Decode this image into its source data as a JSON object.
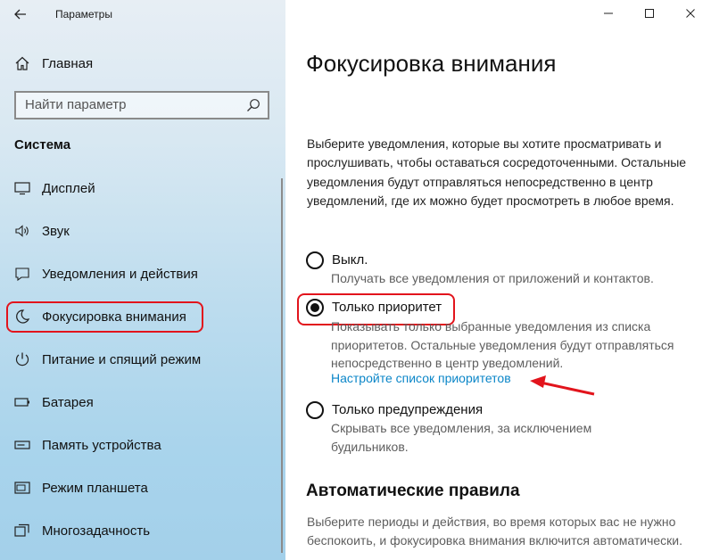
{
  "window": {
    "app_title": "Параметры"
  },
  "sidebar": {
    "home_label": "Главная",
    "search_placeholder": "Найти параметр",
    "section_title": "Система",
    "items": [
      {
        "label": "Дисплей",
        "icon": "display-icon"
      },
      {
        "label": "Звук",
        "icon": "sound-icon"
      },
      {
        "label": "Уведомления и действия",
        "icon": "notifications-icon"
      },
      {
        "label": "Фокусировка внимания",
        "icon": "moon-icon",
        "selected": true
      },
      {
        "label": "Питание и спящий режим",
        "icon": "power-icon"
      },
      {
        "label": "Батарея",
        "icon": "battery-icon"
      },
      {
        "label": "Память устройства",
        "icon": "storage-icon"
      },
      {
        "label": "Режим планшета",
        "icon": "tablet-icon"
      },
      {
        "label": "Многозадачность",
        "icon": "multitasking-icon"
      }
    ]
  },
  "content": {
    "title": "Фокусировка внимания",
    "description": "Выберите уведомления, которые вы хотите просматривать и прослушивать, чтобы оставаться сосредоточенными. Остальные уведомления будут отправляться непосредственно в центр уведомлений, где их можно будет просмотреть в любое время.",
    "options": [
      {
        "label": "Выкл.",
        "desc": "Получать все уведомления от приложений и контактов.",
        "checked": false
      },
      {
        "label": "Только приоритет",
        "desc": "Показывать только выбранные уведомления из списка приоритетов. Остальные уведомления будут отправляться непосредственно в центр уведомлений.",
        "checked": true
      },
      {
        "label": "Только предупреждения",
        "desc": "Скрывать все уведомления, за исключением будильников.",
        "checked": false
      }
    ],
    "priority_link": "Настройте список приоритетов",
    "auto_rules_title": "Автоматические правила",
    "auto_rules_desc": "Выберите периоды и действия, во время которых вас не нужно беспокоить, и фокусировка внимания включится автоматически."
  },
  "colors": {
    "accent_link": "#0b86c8",
    "annotation_red": "#e2141c"
  }
}
